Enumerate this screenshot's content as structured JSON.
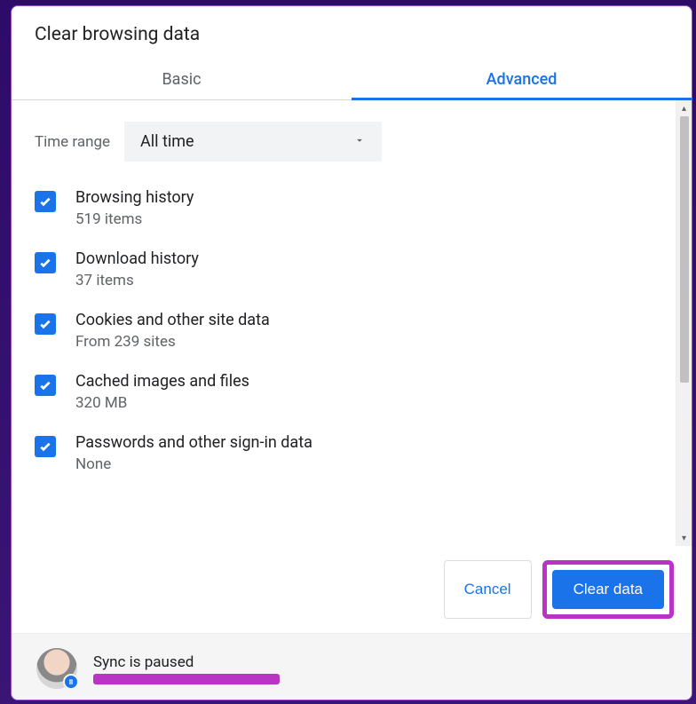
{
  "dialog": {
    "title": "Clear browsing data",
    "tabs": {
      "basic": "Basic",
      "advanced": "Advanced",
      "active": "advanced"
    },
    "timeRange": {
      "label": "Time range",
      "value": "All time"
    },
    "options": [
      {
        "title": "Browsing history",
        "sub": "519 items",
        "checked": true
      },
      {
        "title": "Download history",
        "sub": "37 items",
        "checked": true
      },
      {
        "title": "Cookies and other site data",
        "sub": "From 239 sites",
        "checked": true
      },
      {
        "title": "Cached images and files",
        "sub": "320 MB",
        "checked": true
      },
      {
        "title": "Passwords and other sign-in data",
        "sub": "None",
        "checked": true
      }
    ],
    "buttons": {
      "cancel": "Cancel",
      "clear": "Clear data"
    },
    "sync": {
      "status": "Sync is paused",
      "email_redacted": true
    },
    "colors": {
      "accent": "#1a73e8",
      "highlight": "#b933c5"
    }
  }
}
